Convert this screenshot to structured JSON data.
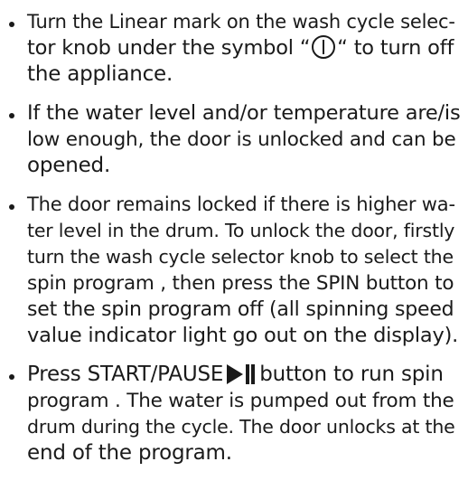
{
  "items": [
    {
      "lines": [
        {
          "before": "Turn the Linear mark on the wash cycle selec-"
        },
        {
          "before": "tor knob under the symbol “",
          "icon": "power-icon",
          "after": "“ to turn off"
        },
        {
          "before": "the appliance."
        }
      ]
    },
    {
      "lines": [
        {
          "before": "If the water level and/or temperature are/is"
        },
        {
          "before": "low enough, the door is unlocked and can be"
        },
        {
          "before": "opened."
        }
      ]
    },
    {
      "lines": [
        {
          "before": "The door remains locked if there is higher wa-"
        },
        {
          "before": "ter level in the drum. To unlock the door, firstly"
        },
        {
          "before": "turn the wash cycle selector knob to select the"
        },
        {
          "before": "spin program , then press the SPIN button to"
        },
        {
          "before": "set the spin program off (all spinning speed"
        },
        {
          "before": "value indicator light go out on the display)."
        }
      ]
    },
    {
      "lines": [
        {
          "before": "Press START/PAUSE",
          "icon": "play-pause-icon",
          "after": "button to run spin"
        },
        {
          "before": "program . The water is pumped out from the"
        },
        {
          "before": "drum during the cycle. The door unlocks at the"
        },
        {
          "before": "end of the program."
        }
      ]
    }
  ]
}
